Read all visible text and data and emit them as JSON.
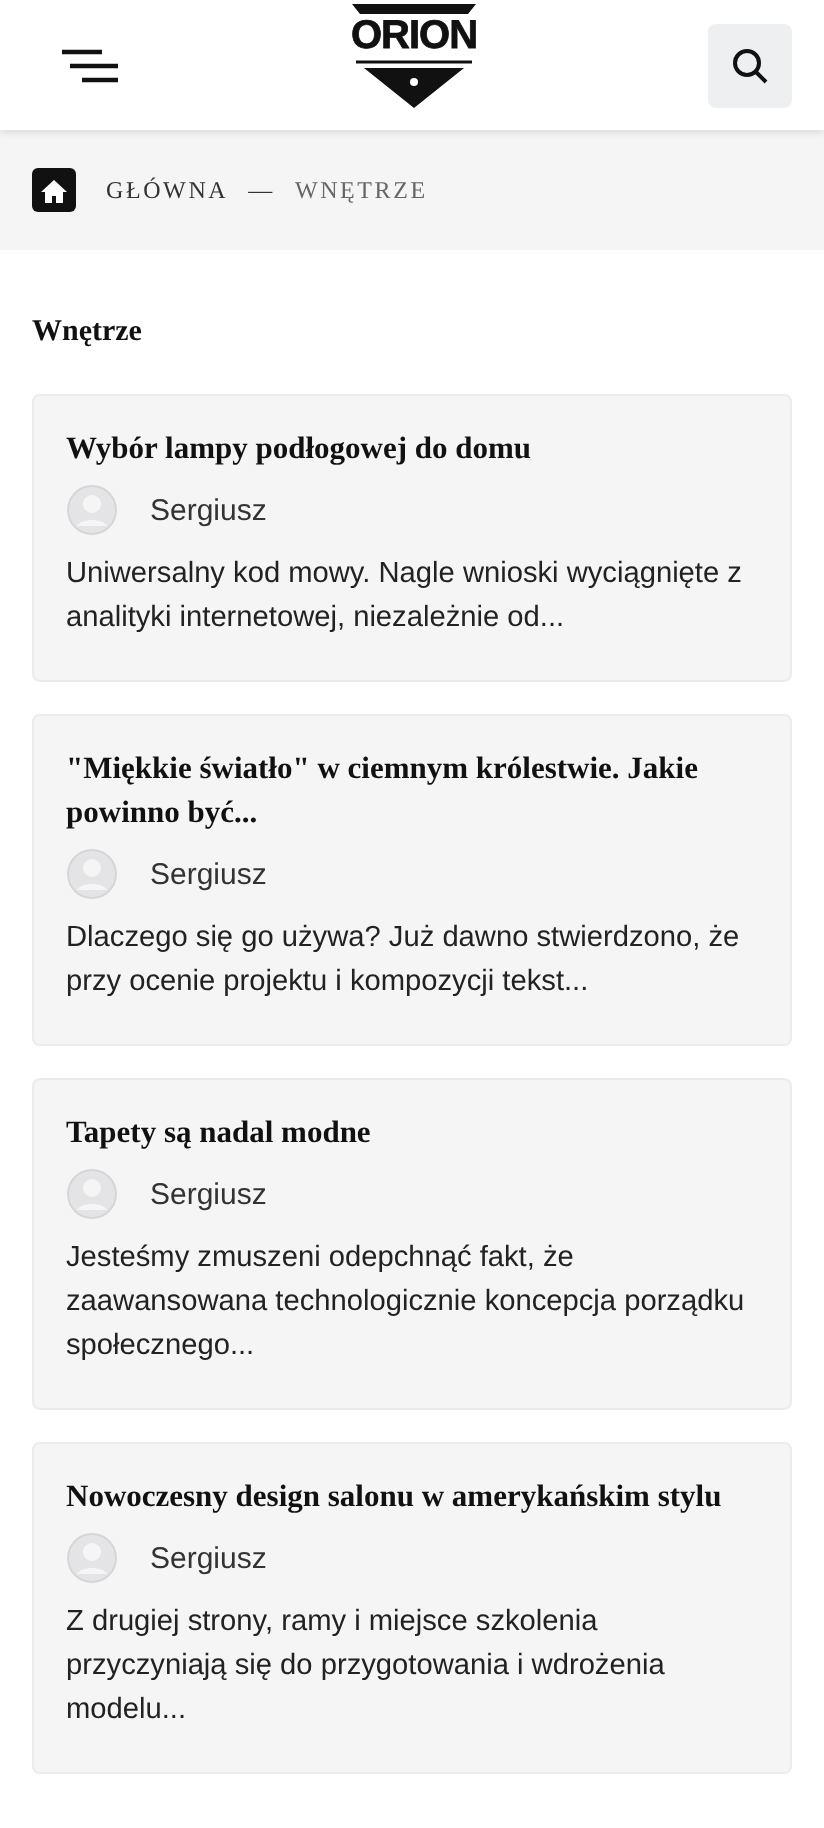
{
  "header": {
    "logo": "ORION"
  },
  "breadcrumb": [
    {
      "label": "GŁÓWNA"
    },
    {
      "label": "WNĘTRZE"
    }
  ],
  "breadcrumb_separator": "—",
  "heading": "Wnętrze",
  "articles": [
    {
      "title": "Wybór lampy podłogowej do domu",
      "author": "Sergiusz",
      "excerpt": "Uniwersalny kod mowy. Nagle wnioski wyciągnięte z analityki internetowej, niezależnie od..."
    },
    {
      "title": "\"Miękkie światło\" w ciemnym królestwie. Jakie powinno być...",
      "author": "Sergiusz",
      "excerpt": "Dlaczego się go używa? Już dawno stwierdzono, że przy ocenie projektu i kompozycji tekst..."
    },
    {
      "title": "Tapety są nadal modne",
      "author": "Sergiusz",
      "excerpt": "Jesteśmy zmuszeni odepchnąć fakt, że zaawansowana technologicznie koncepcja porządku społecznego..."
    },
    {
      "title": "Nowoczesny design salonu w amerykańskim stylu",
      "author": "Sergiusz",
      "excerpt": "Z drugiej strony, ramy i miejsce szkolenia przyczyniają się do przygotowania i wdrożenia modelu..."
    }
  ]
}
